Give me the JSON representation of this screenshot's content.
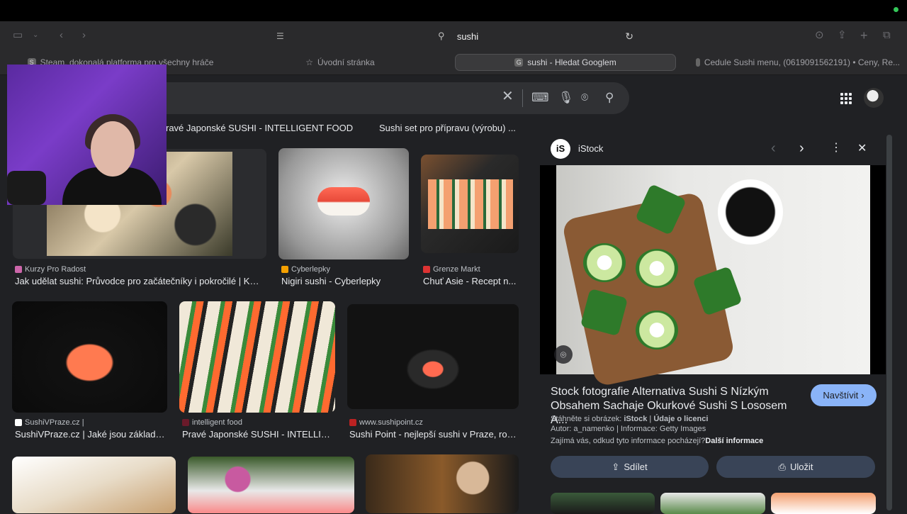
{
  "browser": {
    "address": "sushi",
    "tabs": [
      {
        "label": "Steam, dokonalá platforma pro všechny hráče",
        "fav": "S"
      },
      {
        "label": "Úvodní stránka",
        "fav": "☆"
      },
      {
        "label": "sushi - Hledat Googlem",
        "fav": "G"
      },
      {
        "label": "Cedule Sushi menu, (0619091562191) • Ceny, Re...",
        "fav": ""
      }
    ]
  },
  "results": [
    {
      "caption": "ravé Japonské SUSHI - INTELLIGENT FOOD"
    },
    {
      "caption": "Sushi set pro přípravu (výrobu) ..."
    },
    {
      "source": "Kurzy Pro Radost",
      "caption": "Jak udělat sushi: Průvodce pro začátečníky i pokročilé | Kur..."
    },
    {
      "source": "Cyberlepky",
      "caption": "Nigiri sushi - Cyberlepky"
    },
    {
      "source": "Grenze Markt",
      "caption": "Chuť Asie - Recept n..."
    },
    {
      "source": "SushiVPraze.cz |",
      "caption": "SushiVPraze.cz | Jaké jsou základn..."
    },
    {
      "source": "intelligent food",
      "caption": "Pravé Japonské SUSHI - INTELLIG..."
    },
    {
      "source": "www.sushipoint.cz",
      "caption": "Sushi Point - nejlepší sushi v Praze, roz..."
    }
  ],
  "panel": {
    "site": "iStock",
    "logo": "iS",
    "title_line1": "Stock fotografie Alternativa Sushi S Nízkým",
    "title_line2": "Obsahem Sachaje Okurkové Sushi S Lososem A...",
    "visit": "Navštívit",
    "download_prefix": "Stáhněte si obrázek:",
    "download_site": "iStock",
    "license": "Údaje o licenci",
    "author": "Autor: a_namenko | Informace: Getty Images",
    "info_q": "Zajímá vás, odkud tyto informace pocházejí?",
    "more_info": "Další informace",
    "share": "Sdílet",
    "save": "Uložit"
  },
  "icons": {
    "clear": "close-icon",
    "keyboard": "keyboard-icon",
    "voice": "mic-icon",
    "lens": "camera-icon",
    "search": "search-icon"
  }
}
